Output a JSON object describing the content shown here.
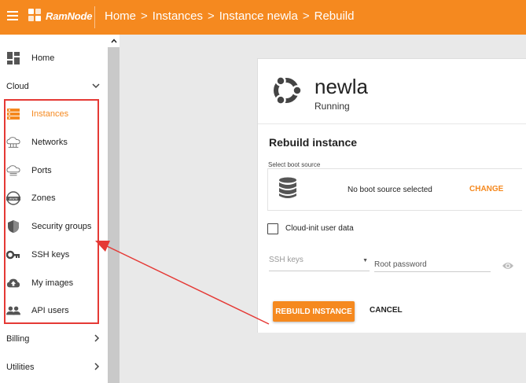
{
  "header": {
    "brand": "RamNode",
    "breadcrumb": [
      "Home",
      "Instances",
      "Instance newla",
      "Rebuild"
    ],
    "separator": ">"
  },
  "sidebar": {
    "items": [
      {
        "label": "Home",
        "icon": "dashboard-icon",
        "type": "item"
      },
      {
        "label": "Cloud",
        "icon": "chevron-down-icon",
        "type": "section",
        "expanded": true
      },
      {
        "label": "Instances",
        "icon": "server-icon",
        "type": "item",
        "active": true
      },
      {
        "label": "Networks",
        "icon": "network-cloud-icon",
        "type": "item"
      },
      {
        "label": "Ports",
        "icon": "ports-cloud-icon",
        "type": "item"
      },
      {
        "label": "Zones",
        "icon": "www-globe-icon",
        "type": "item"
      },
      {
        "label": "Security groups",
        "icon": "shield-icon",
        "type": "item"
      },
      {
        "label": "SSH keys",
        "icon": "key-icon",
        "type": "item"
      },
      {
        "label": "My images",
        "icon": "cloud-upload-icon",
        "type": "item"
      },
      {
        "label": "API users",
        "icon": "people-icon",
        "type": "item"
      },
      {
        "label": "Billing",
        "icon": "chevron-right-icon",
        "type": "section"
      },
      {
        "label": "Utilities",
        "icon": "chevron-right-icon",
        "type": "section"
      }
    ]
  },
  "instance": {
    "name": "newla",
    "status": "Running",
    "os_icon": "ubuntu-icon"
  },
  "rebuild": {
    "title": "Rebuild instance",
    "boot_source_label": "Select boot source",
    "boot_source_value": "No boot source selected",
    "change_label": "CHANGE",
    "cloud_init_label": "Cloud-init user data",
    "ssh_keys_placeholder": "SSH keys",
    "root_password_placeholder": "Root password",
    "rebuild_button": "REBUILD INSTANCE",
    "cancel_button": "CANCEL"
  },
  "colors": {
    "accent": "#f5891f",
    "annotation": "#e53935"
  }
}
